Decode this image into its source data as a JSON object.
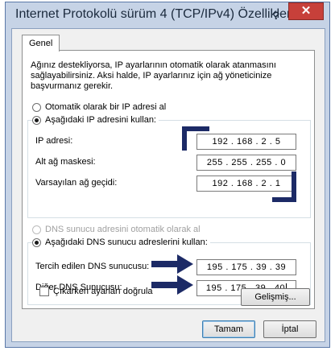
{
  "window": {
    "title": "Internet Protokolü sürüm 4 (TCP/IPv4) Özellikleri",
    "help_label": "?",
    "close_label": "✕"
  },
  "tabs": [
    {
      "label": "Genel"
    }
  ],
  "description": "Ağınız destekliyorsa, IP ayarlarının otomatik olarak atanmasını sağlayabilirsiniz. Aksi halde, IP ayarlarınız için ağ yöneticinize başvurmanız gerekir.",
  "ip_section": {
    "auto_label": "Otomatik olarak bir IP adresi al",
    "manual_label": "Aşağıdaki IP adresini kullan:",
    "fields": [
      {
        "label": "IP adresi:",
        "value": "192 . 168 .  2  .  5"
      },
      {
        "label": "Alt ağ maskesi:",
        "value": "255 . 255 . 255 .  0"
      },
      {
        "label": "Varsayılan ağ geçidi:",
        "value": "192 . 168 .  2  .  1"
      }
    ]
  },
  "dns_section": {
    "auto_label": "DNS sunucu adresini otomatik olarak al",
    "manual_label": "Aşağıdaki DNS sunucu adreslerini kullan:",
    "fields": [
      {
        "label": "Tercih edilen DNS sunucusu:",
        "value": "195 . 175 . 39 . 39"
      },
      {
        "label": "Diğer DNS Sunucusu:",
        "value": "195 . 175 . 39 . 40"
      }
    ]
  },
  "validate_label": "Çıkarken ayarları doğrula",
  "buttons": {
    "advanced": "Gelişmiş...",
    "ok": "Tamam",
    "cancel": "İptal"
  },
  "colors": {
    "annotation": "#1c2a66",
    "close_button": "#c7403a"
  }
}
